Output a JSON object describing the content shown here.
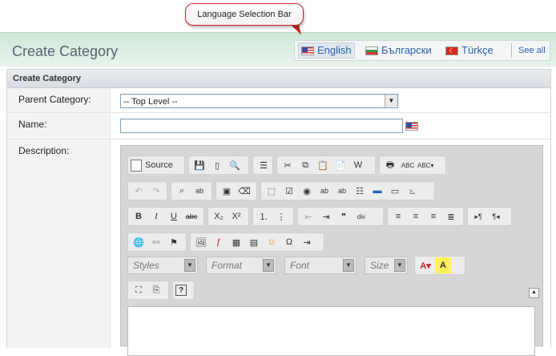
{
  "callout": "Language Selection Bar",
  "page_title": "Create Category",
  "languages": [
    {
      "label": "English",
      "flag": "us-flag-icon"
    },
    {
      "label": "Български",
      "flag": "bg-flag-icon"
    },
    {
      "label": "Türkçe",
      "flag": "tr-flag-icon"
    }
  ],
  "see_all": "See all",
  "form": {
    "heading": "Create Category",
    "parent_label": "Parent Category:",
    "parent_value": "-- Top Level --",
    "name_label": "Name:",
    "name_value": "",
    "description_label": "Description:"
  },
  "editor": {
    "source_label": "Source",
    "combos": {
      "styles": "Styles",
      "format": "Format",
      "font": "Font",
      "size": "Size"
    },
    "toolbar_icons": [
      "save-icon",
      "new-page-icon",
      "preview-icon",
      "templates-icon",
      "cut-icon",
      "copy-icon",
      "paste-icon",
      "paste-text-icon",
      "paste-word-icon",
      "print-icon",
      "spellcheck-icon",
      "scayt-icon",
      "undo-icon",
      "redo-icon",
      "find-icon",
      "replace-icon",
      "select-all-icon",
      "remove-format-icon",
      "form-icon",
      "checkbox-icon",
      "radio-icon",
      "textfield-icon",
      "textarea-icon",
      "select-field-icon",
      "button-icon",
      "image-button-icon",
      "hidden-field-icon",
      "bold-icon",
      "italic-icon",
      "underline-icon",
      "strike-icon",
      "subscript-icon",
      "superscript-icon",
      "numbered-list-icon",
      "bulleted-list-icon",
      "outdent-icon",
      "indent-icon",
      "blockquote-icon",
      "div-icon",
      "align-left-icon",
      "align-center-icon",
      "align-right-icon",
      "justify-icon",
      "ltr-icon",
      "rtl-icon",
      "link-icon",
      "unlink-icon",
      "anchor-icon",
      "image-icon",
      "flash-icon",
      "table-icon",
      "horizontal-rule-icon",
      "smiley-icon",
      "special-char-icon",
      "page-break-icon",
      "text-color-icon",
      "bg-color-icon",
      "maximize-icon",
      "show-blocks-icon",
      "about-icon"
    ]
  }
}
